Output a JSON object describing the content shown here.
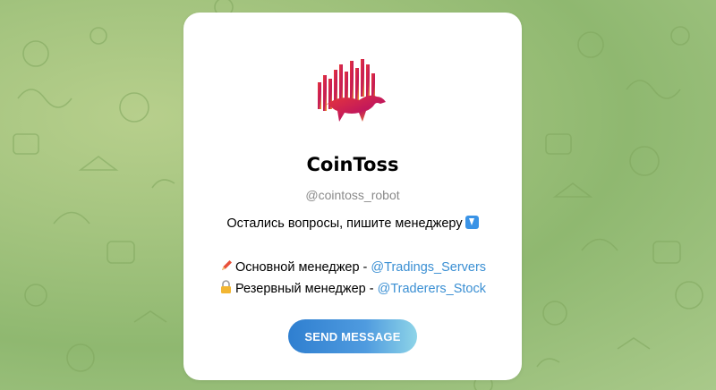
{
  "bot": {
    "name": "CoinToss",
    "username": "@cointoss_robot",
    "logo_icon": "bull-candlestick-logo"
  },
  "description": {
    "line1": "Остались вопросы, пишите менеджеру",
    "line1_icon": "arrow-down-emoji",
    "manager_main_label": "Основной менеджер - ",
    "manager_main_link": "@Tradings_Servers",
    "manager_main_icon": "pencil-emoji",
    "manager_reserve_label": "Резервный менеджер - ",
    "manager_reserve_link": "@Traderers_Stock",
    "manager_reserve_icon": "lock-emoji"
  },
  "actions": {
    "send_message_label": "SEND MESSAGE"
  },
  "colors": {
    "link": "#3a8fd3",
    "button_start": "#2f7fd0",
    "button_end": "#8ed4e8",
    "background": "#a4c47f"
  }
}
